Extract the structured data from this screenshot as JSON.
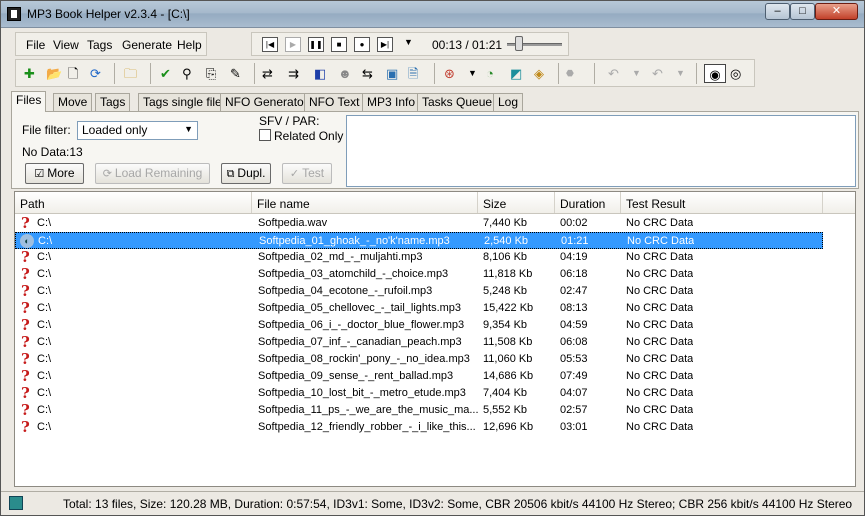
{
  "window": {
    "title": "MP3 Book Helper v2.3.4 - [C:\\]",
    "min_label": "–",
    "max_label": "□",
    "close_label": "✕"
  },
  "menu": {
    "file": "File",
    "view": "View",
    "tags": "Tags",
    "generate": "Generate",
    "help": "Help"
  },
  "player": {
    "time": "00:13 / 01:21",
    "progress": 0.16
  },
  "tabs": [
    "Files",
    "Move",
    "Tags",
    "Tags single file",
    "NFO Generator",
    "NFO Text",
    "MP3 Info",
    "Tasks Queue",
    "Log"
  ],
  "active_tab": "Files",
  "filter": {
    "label": "File filter:",
    "value": "Loaded only",
    "no_data": "No Data:13",
    "sfv_label": "SFV / PAR:",
    "related_only": "Related Only"
  },
  "buttons": {
    "more": "More",
    "load_remaining": "Load Remaining",
    "dupl": "Dupl.",
    "test": "Test"
  },
  "columns": {
    "path": "Path",
    "file_name": "File name",
    "size": "Size",
    "duration": "Duration",
    "test_result": "Test Result"
  },
  "rows": [
    {
      "path": "C:\\",
      "file": "Softpedia.wav",
      "size": "7,440 Kb",
      "duration": "00:02",
      "test": "No CRC Data",
      "selected": false
    },
    {
      "path": "C:\\",
      "file": "Softpedia_01_ghoak_-_no'k'name.mp3",
      "size": "2,540 Kb",
      "duration": "01:21",
      "test": "No CRC Data",
      "selected": true
    },
    {
      "path": "C:\\",
      "file": "Softpedia_02_md_-_muljahti.mp3",
      "size": "8,106 Kb",
      "duration": "04:19",
      "test": "No CRC Data",
      "selected": false
    },
    {
      "path": "C:\\",
      "file": "Softpedia_03_atomchild_-_choice.mp3",
      "size": "11,818 Kb",
      "duration": "06:18",
      "test": "No CRC Data",
      "selected": false
    },
    {
      "path": "C:\\",
      "file": "Softpedia_04_ecotone_-_rufoil.mp3",
      "size": "5,248 Kb",
      "duration": "02:47",
      "test": "No CRC Data",
      "selected": false
    },
    {
      "path": "C:\\",
      "file": "Softpedia_05_chellovec_-_tail_lights.mp3",
      "size": "15,422 Kb",
      "duration": "08:13",
      "test": "No CRC Data",
      "selected": false
    },
    {
      "path": "C:\\",
      "file": "Softpedia_06_i_-_doctor_blue_flower.mp3",
      "size": "9,354 Kb",
      "duration": "04:59",
      "test": "No CRC Data",
      "selected": false
    },
    {
      "path": "C:\\",
      "file": "Softpedia_07_inf_-_canadian_peach.mp3",
      "size": "11,508 Kb",
      "duration": "06:08",
      "test": "No CRC Data",
      "selected": false
    },
    {
      "path": "C:\\",
      "file": "Softpedia_08_rockin'_pony_-_no_idea.mp3",
      "size": "11,060 Kb",
      "duration": "05:53",
      "test": "No CRC Data",
      "selected": false
    },
    {
      "path": "C:\\",
      "file": "Softpedia_09_sense_-_rent_ballad.mp3",
      "size": "14,686 Kb",
      "duration": "07:49",
      "test": "No CRC Data",
      "selected": false
    },
    {
      "path": "C:\\",
      "file": "Softpedia_10_lost_bit_-_metro_etude.mp3",
      "size": "7,404 Kb",
      "duration": "04:07",
      "test": "No CRC Data",
      "selected": false
    },
    {
      "path": "C:\\",
      "file": "Softpedia_11_ps_-_we_are_the_music_ma...",
      "size": "5,552 Kb",
      "duration": "02:57",
      "test": "No CRC Data",
      "selected": false
    },
    {
      "path": "C:\\",
      "file": "Softpedia_12_friendly_robber_-_i_like_this...",
      "size": "12,696 Kb",
      "duration": "03:01",
      "test": "No CRC Data",
      "selected": false
    }
  ],
  "status": "Total: 13 files, Size: 120.28 MB, Duration: 0:57:54, ID3v1: Some, ID3v2: Some, CBR 20506 kbit/s 44100 Hz Stereo; CBR 256 kbit/s 44100 Hz Stereo"
}
